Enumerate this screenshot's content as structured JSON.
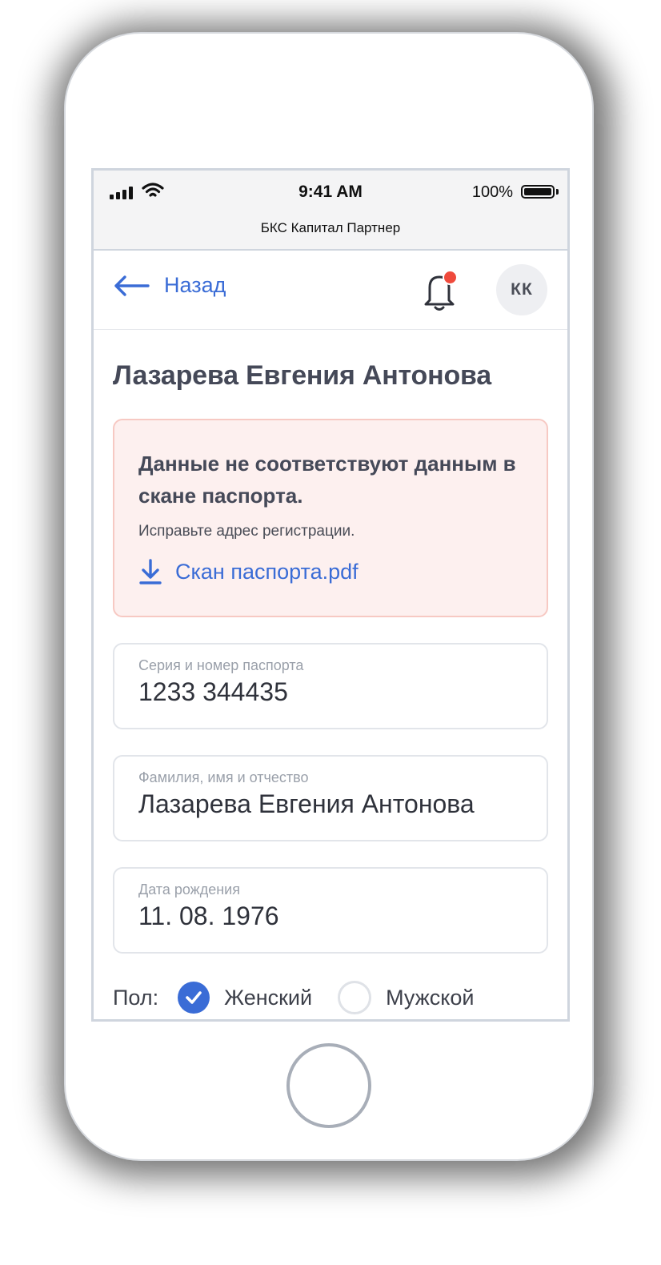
{
  "status_bar": {
    "time": "9:41 AM",
    "battery": "100%",
    "app_name": "БКС Капитал Партнер"
  },
  "nav": {
    "back_label": "Назад",
    "avatar_initials": "КК",
    "notification_dot_color": "#ef4a3c"
  },
  "page": {
    "title": "Лазарева Евгения Антонова"
  },
  "alert": {
    "title": "Данные не соответствуют данным в скане паспорта.",
    "subtitle": "Исправьте адрес регистрации.",
    "link_label": "Скан паспорта.pdf",
    "link_icon": "download-icon"
  },
  "fields": [
    {
      "label": "Серия и номер паспорта",
      "value": "1233 344435"
    },
    {
      "label": "Фамилия, имя и отчество",
      "value": "Лазарева Евгения Антонова"
    },
    {
      "label": "Дата рождения",
      "value": "11. 08. 1976"
    }
  ],
  "gender": {
    "label": "Пол:",
    "options": [
      {
        "label": "Женский",
        "selected": true
      },
      {
        "label": "Мужской",
        "selected": false
      }
    ]
  },
  "colors": {
    "accent": "#3a6cd6",
    "alert_bg": "#fdf0ef",
    "alert_border": "#f7c9c3"
  }
}
